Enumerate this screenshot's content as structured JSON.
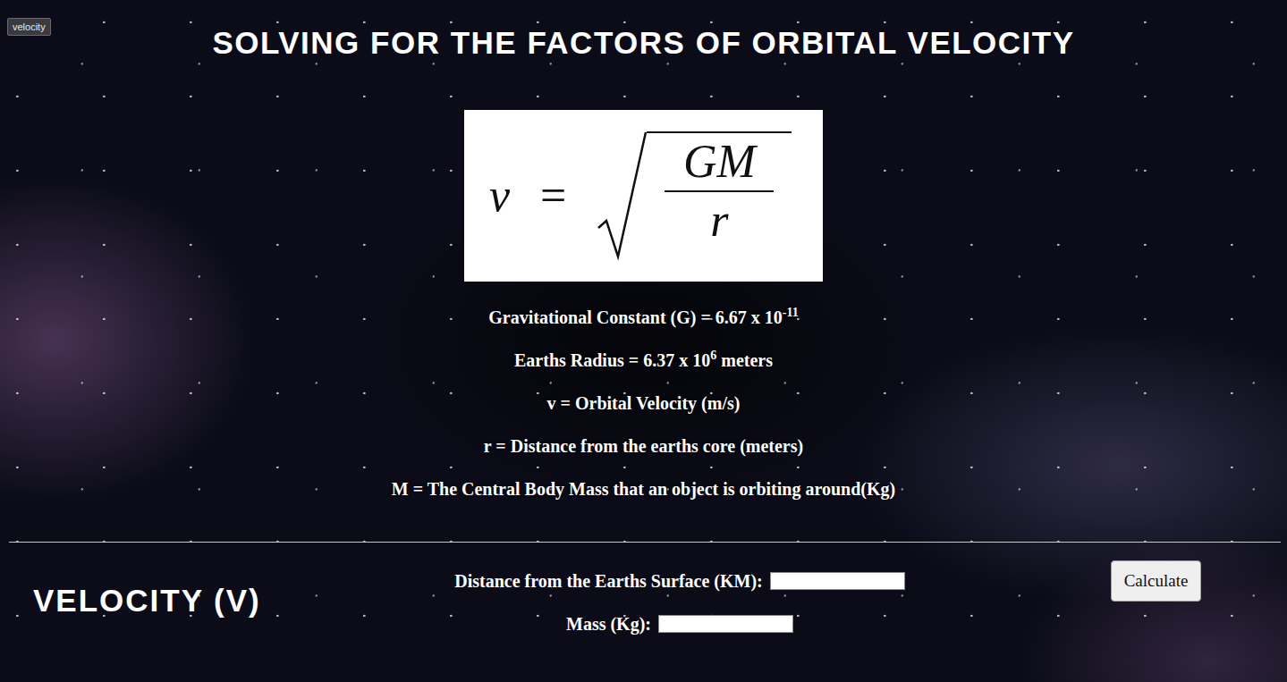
{
  "badge": "velocity",
  "title": "SOLVING FOR THE FACTORS OF ORBITAL VELOCITY",
  "formula": {
    "lhs": "v",
    "equals": "=",
    "numerator": "GM",
    "denominator": "r"
  },
  "definitions": [
    {
      "text": "Gravitational Constant (G) = 6.67 x 10",
      "sup": "-11"
    },
    {
      "text": "Earths Radius = 6.37 x 10",
      "sup": "6",
      "suffix": " meters"
    },
    {
      "text": "v = Orbital Velocity (m/s)"
    },
    {
      "text": "r = Distance from the earths core (meters)"
    },
    {
      "text": "M = The Central Body Mass that an object is orbiting around(Kg)"
    }
  ],
  "calculator": {
    "heading": "VELOCITY (V)",
    "fields": [
      {
        "label": "Distance from the Earths Surface (KM):",
        "value": ""
      },
      {
        "label": "Mass (Kg):",
        "value": ""
      }
    ],
    "button": "Calculate"
  }
}
